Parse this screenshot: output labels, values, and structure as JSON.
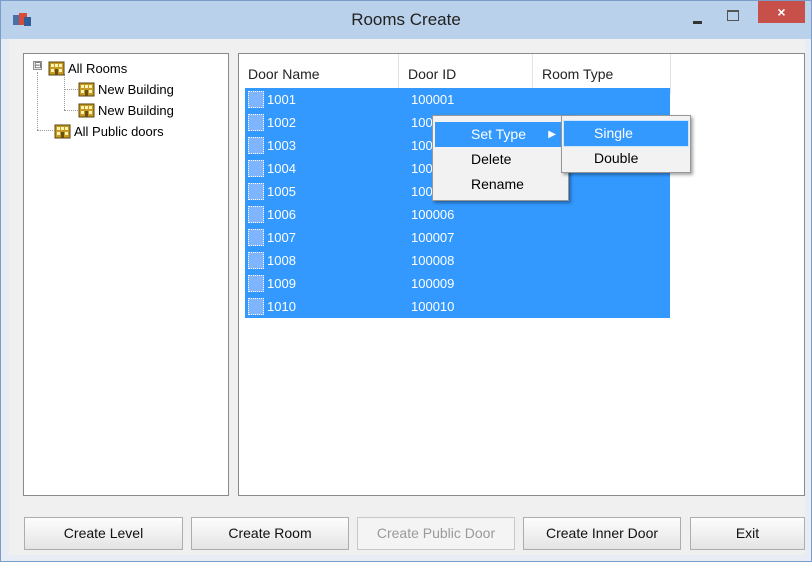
{
  "window": {
    "title": "Rooms Create",
    "close_glyph": "×",
    "accent_color": "#3399ff",
    "close_color": "#c7504b"
  },
  "tree": {
    "root": {
      "label": "All Rooms",
      "expander": "⊟"
    },
    "children": [
      {
        "label": "New Building"
      },
      {
        "label": "New Building"
      }
    ],
    "public": {
      "label": "All Public doors"
    }
  },
  "list": {
    "columns": [
      "Door Name",
      "Door ID",
      "Room Type"
    ],
    "rows": [
      {
        "name": "1001",
        "id": "100001"
      },
      {
        "name": "1002",
        "id": "100002"
      },
      {
        "name": "1003",
        "id": "100003"
      },
      {
        "name": "1004",
        "id": "100004"
      },
      {
        "name": "1005",
        "id": "100005"
      },
      {
        "name": "1006",
        "id": "100006"
      },
      {
        "name": "1007",
        "id": "100007"
      },
      {
        "name": "1008",
        "id": "100008"
      },
      {
        "name": "1009",
        "id": "100009"
      },
      {
        "name": "1010",
        "id": "100010"
      }
    ]
  },
  "context_menu": {
    "items": [
      "Set Type",
      "Delete",
      "Rename"
    ],
    "submenu_arrow": "▶",
    "submenu": [
      "Single",
      "Double"
    ]
  },
  "buttons": {
    "create_level": "Create Level",
    "create_room": "Create Room",
    "create_public_door": "Create Public Door",
    "create_inner_door": "Create Inner Door",
    "exit": "Exit"
  }
}
